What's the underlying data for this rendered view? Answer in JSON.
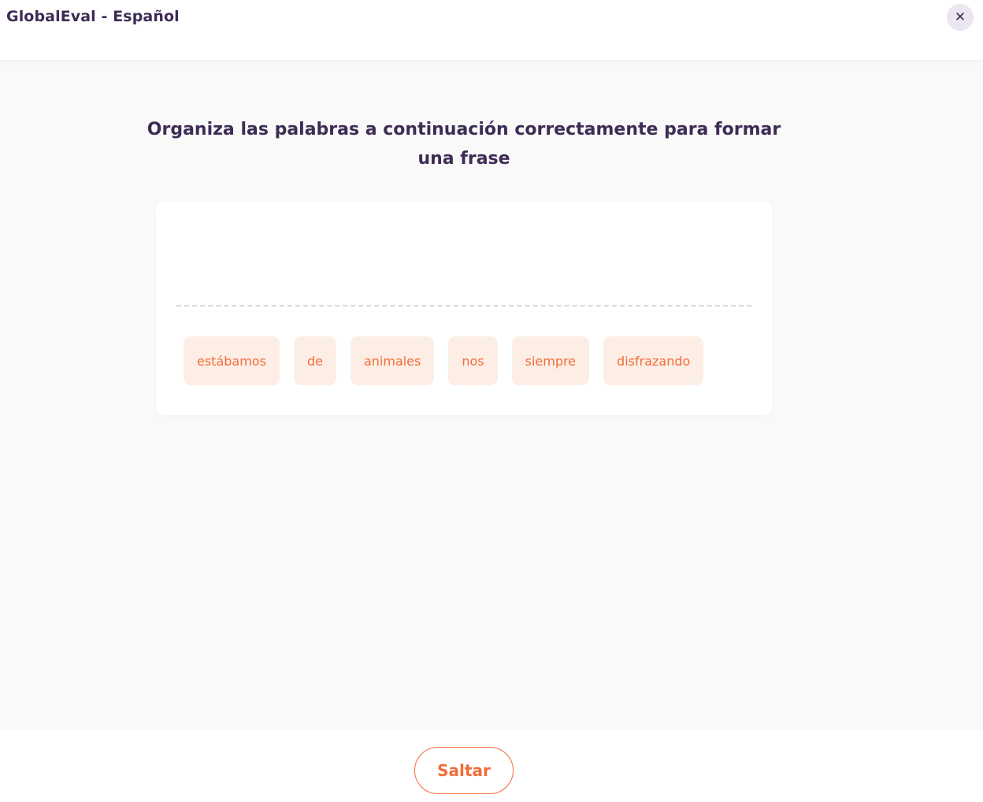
{
  "header": {
    "title": "GlobalEval - Español",
    "close_icon": "close-icon",
    "close_glyph": "✕"
  },
  "exercise": {
    "instruction": "Organiza las palabras a continuación correctamente para formar una frase",
    "answer_words": [],
    "word_bank": [
      "estábamos",
      "de",
      "animales",
      "nos",
      "siempre",
      "disfrazando"
    ]
  },
  "footer": {
    "skip_label": "Saltar"
  },
  "colors": {
    "title_text": "#3d2c54",
    "accent": "#f26c3a",
    "chip_background": "#fdeee5",
    "page_background": "#f9f9f9"
  }
}
